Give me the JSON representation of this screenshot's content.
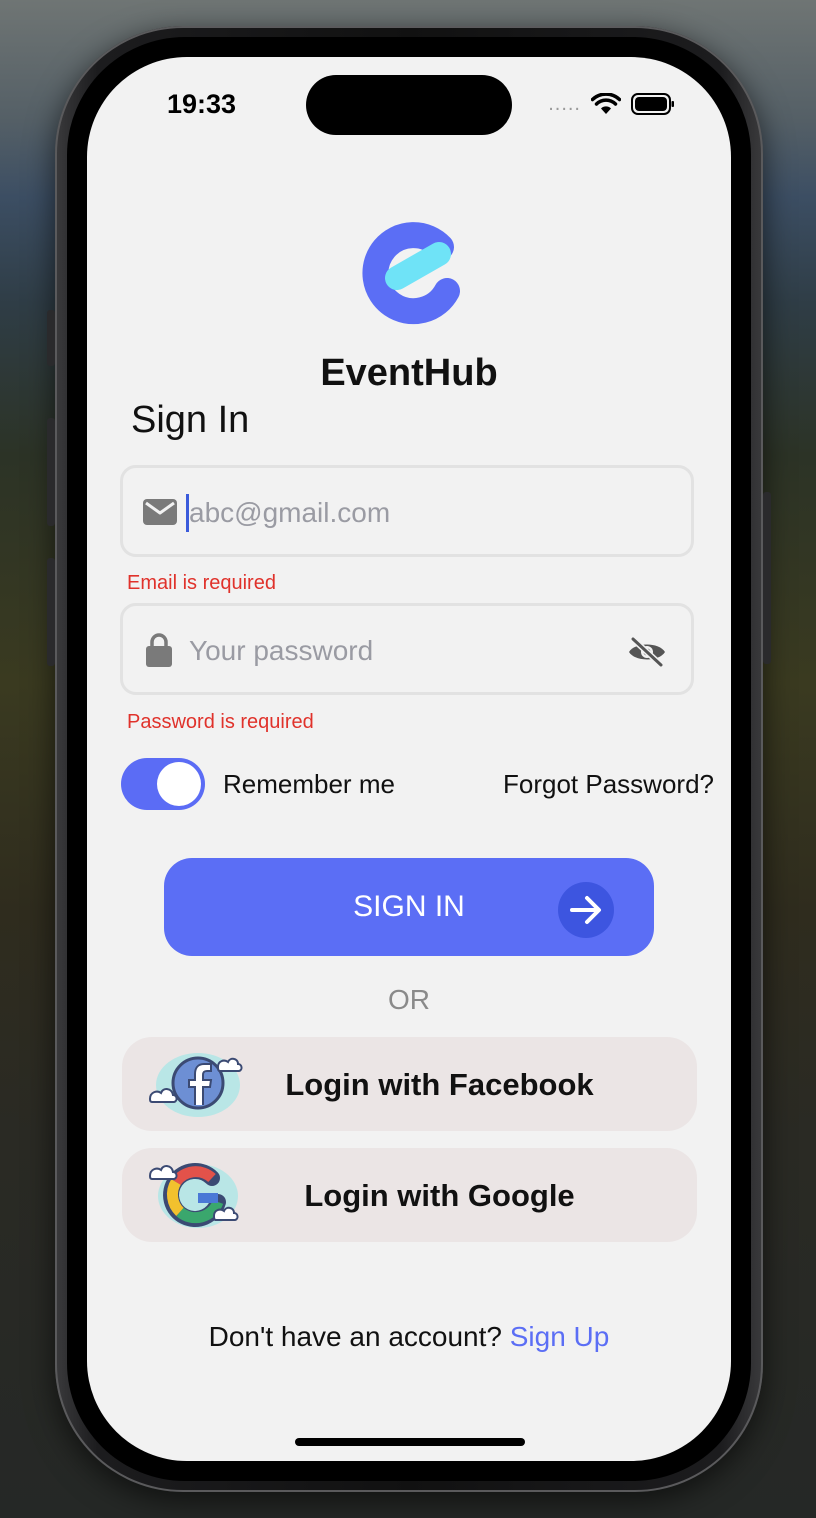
{
  "status_bar": {
    "time": "19:33",
    "signal": "....."
  },
  "app": {
    "name": "EventHub"
  },
  "screen": {
    "title": "Sign In"
  },
  "email": {
    "placeholder": "abc@gmail.com",
    "error": "Email is required"
  },
  "password": {
    "placeholder": "Your password",
    "error": "Password is required"
  },
  "remember": {
    "label": "Remember me",
    "checked": true
  },
  "forgot_label": "Forgot Password?",
  "sign_in_button": "SIGN IN",
  "or_label": "OR",
  "social": {
    "facebook_label": "Login with Facebook",
    "google_label": "Login with Google"
  },
  "footer": {
    "prompt": "Don't have an account? ",
    "link": "Sign Up"
  },
  "colors": {
    "accent": "#5B6EF5",
    "error": "#E0322B",
    "logo_cyan": "#6FE3F7"
  }
}
